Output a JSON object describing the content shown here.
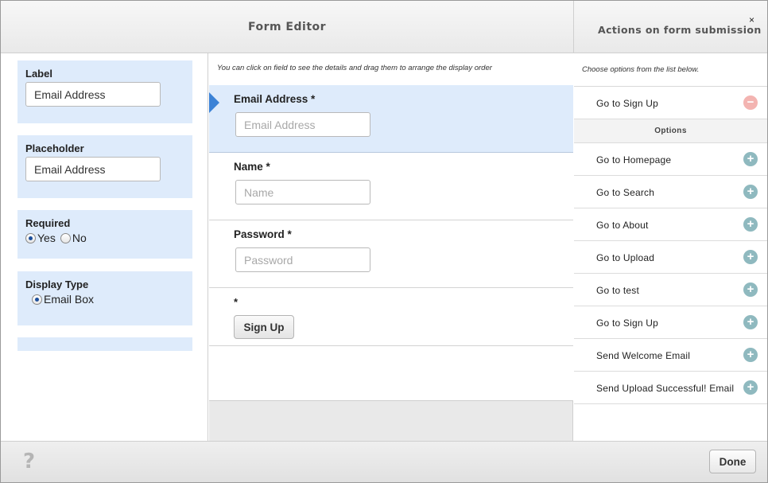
{
  "header": {
    "title": "Form Editor",
    "actions_title": "Actions on form submission",
    "close_label": "×"
  },
  "properties": {
    "label_heading": "Label",
    "label_value": "Email Address",
    "placeholder_heading": "Placeholder",
    "placeholder_value": "Email Address",
    "required_heading": "Required",
    "required_yes": "Yes",
    "required_no": "No",
    "required_selected": "Yes",
    "display_type_heading": "Display Type",
    "display_type_option": "Email Box"
  },
  "form": {
    "hint": "You can click on field to see the details and drag them to arrange the display order",
    "fields": [
      {
        "label": "Email Address *",
        "placeholder": "Email Address",
        "selected": true
      },
      {
        "label": "Name *",
        "placeholder": "Name",
        "selected": false
      },
      {
        "label": "Password *",
        "placeholder": "Password",
        "selected": false
      }
    ],
    "submit_star": "*",
    "submit_label": "Sign Up"
  },
  "actions": {
    "hint": "Choose options from the list below.",
    "selected": [
      {
        "label": "Go to Sign Up"
      }
    ],
    "options_heading": "Options",
    "options": [
      {
        "label": "Go to Homepage"
      },
      {
        "label": "Go to Search"
      },
      {
        "label": "Go to About"
      },
      {
        "label": "Go to Upload"
      },
      {
        "label": "Go to test"
      },
      {
        "label": "Go to Sign Up"
      },
      {
        "label": "Send Welcome Email"
      },
      {
        "label": "Send Upload Successful! Email"
      }
    ],
    "add_symbol": "+",
    "remove_symbol": "−"
  },
  "footer": {
    "help_label": "?",
    "done_label": "Done"
  },
  "colors": {
    "panel_blue": "#deebfb",
    "selection_arrow": "#3b82d6",
    "add_button": "#8fb9bf",
    "remove_button": "#f3b4b1"
  }
}
